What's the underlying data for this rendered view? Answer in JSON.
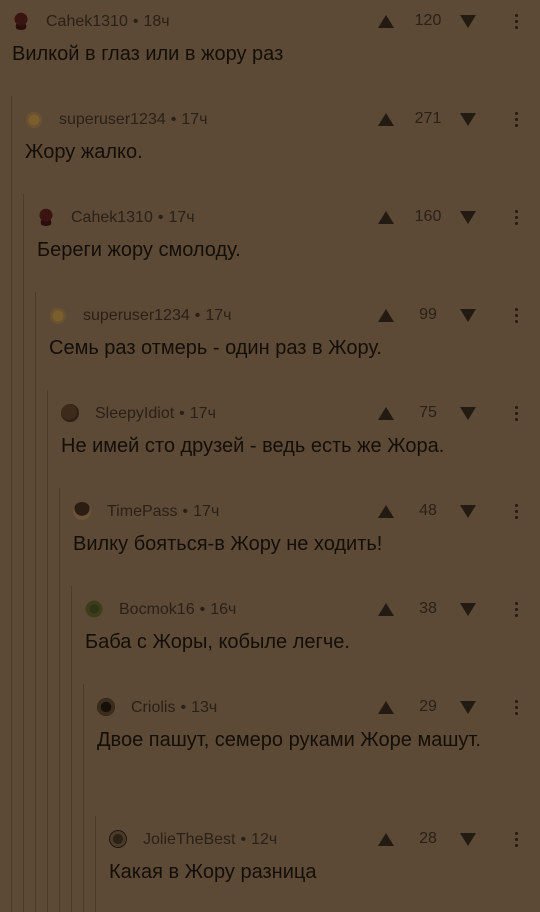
{
  "comments": [
    {
      "avatar": "skull-avatar",
      "author": "Cahek1310",
      "time": "18ч",
      "score": "120",
      "text": "Вилкой в глаз или в жору раз"
    },
    {
      "avatar": "cake-avatar",
      "author": "superuser1234",
      "time": "17ч",
      "score": "271",
      "text": "Жору жалко."
    },
    {
      "avatar": "skull-avatar",
      "author": "Cahek1310",
      "time": "17ч",
      "score": "160",
      "text": "Береги жору смолоду."
    },
    {
      "avatar": "cake-avatar",
      "author": "superuser1234",
      "time": "17ч",
      "score": "99",
      "text": "Семь раз отмерь - один раз в Жору."
    },
    {
      "avatar": "face-avatar",
      "author": "SleepyIdiot",
      "time": "17ч",
      "score": "75",
      "text": "Не имей сто друзей - ведь есть же Жора."
    },
    {
      "avatar": "hair-avatar",
      "author": "TimePass",
      "time": "17ч",
      "score": "48",
      "text": "Вилку бояться-в Жору не ходить!"
    },
    {
      "avatar": "green-avatar",
      "author": "Bocmok16",
      "time": "16ч",
      "score": "38",
      "text": "Баба с Жоры, кобыле легче."
    },
    {
      "avatar": "dark-avatar",
      "author": "Criolis",
      "time": "13ч",
      "score": "29",
      "text": "Двое пашут, семеро руками Жоре машут."
    },
    {
      "avatar": "gear-avatar",
      "author": "JolieTheBest",
      "time": "12ч",
      "score": "28",
      "text": "Какая в Жору разница"
    }
  ],
  "icons": {
    "upvote": "arrow-up-icon",
    "downvote": "arrow-down-icon",
    "more": "more-vertical-icon"
  },
  "colors": {
    "background": "#5c4a36",
    "text": "#140e08",
    "meta": "#2a2017"
  }
}
